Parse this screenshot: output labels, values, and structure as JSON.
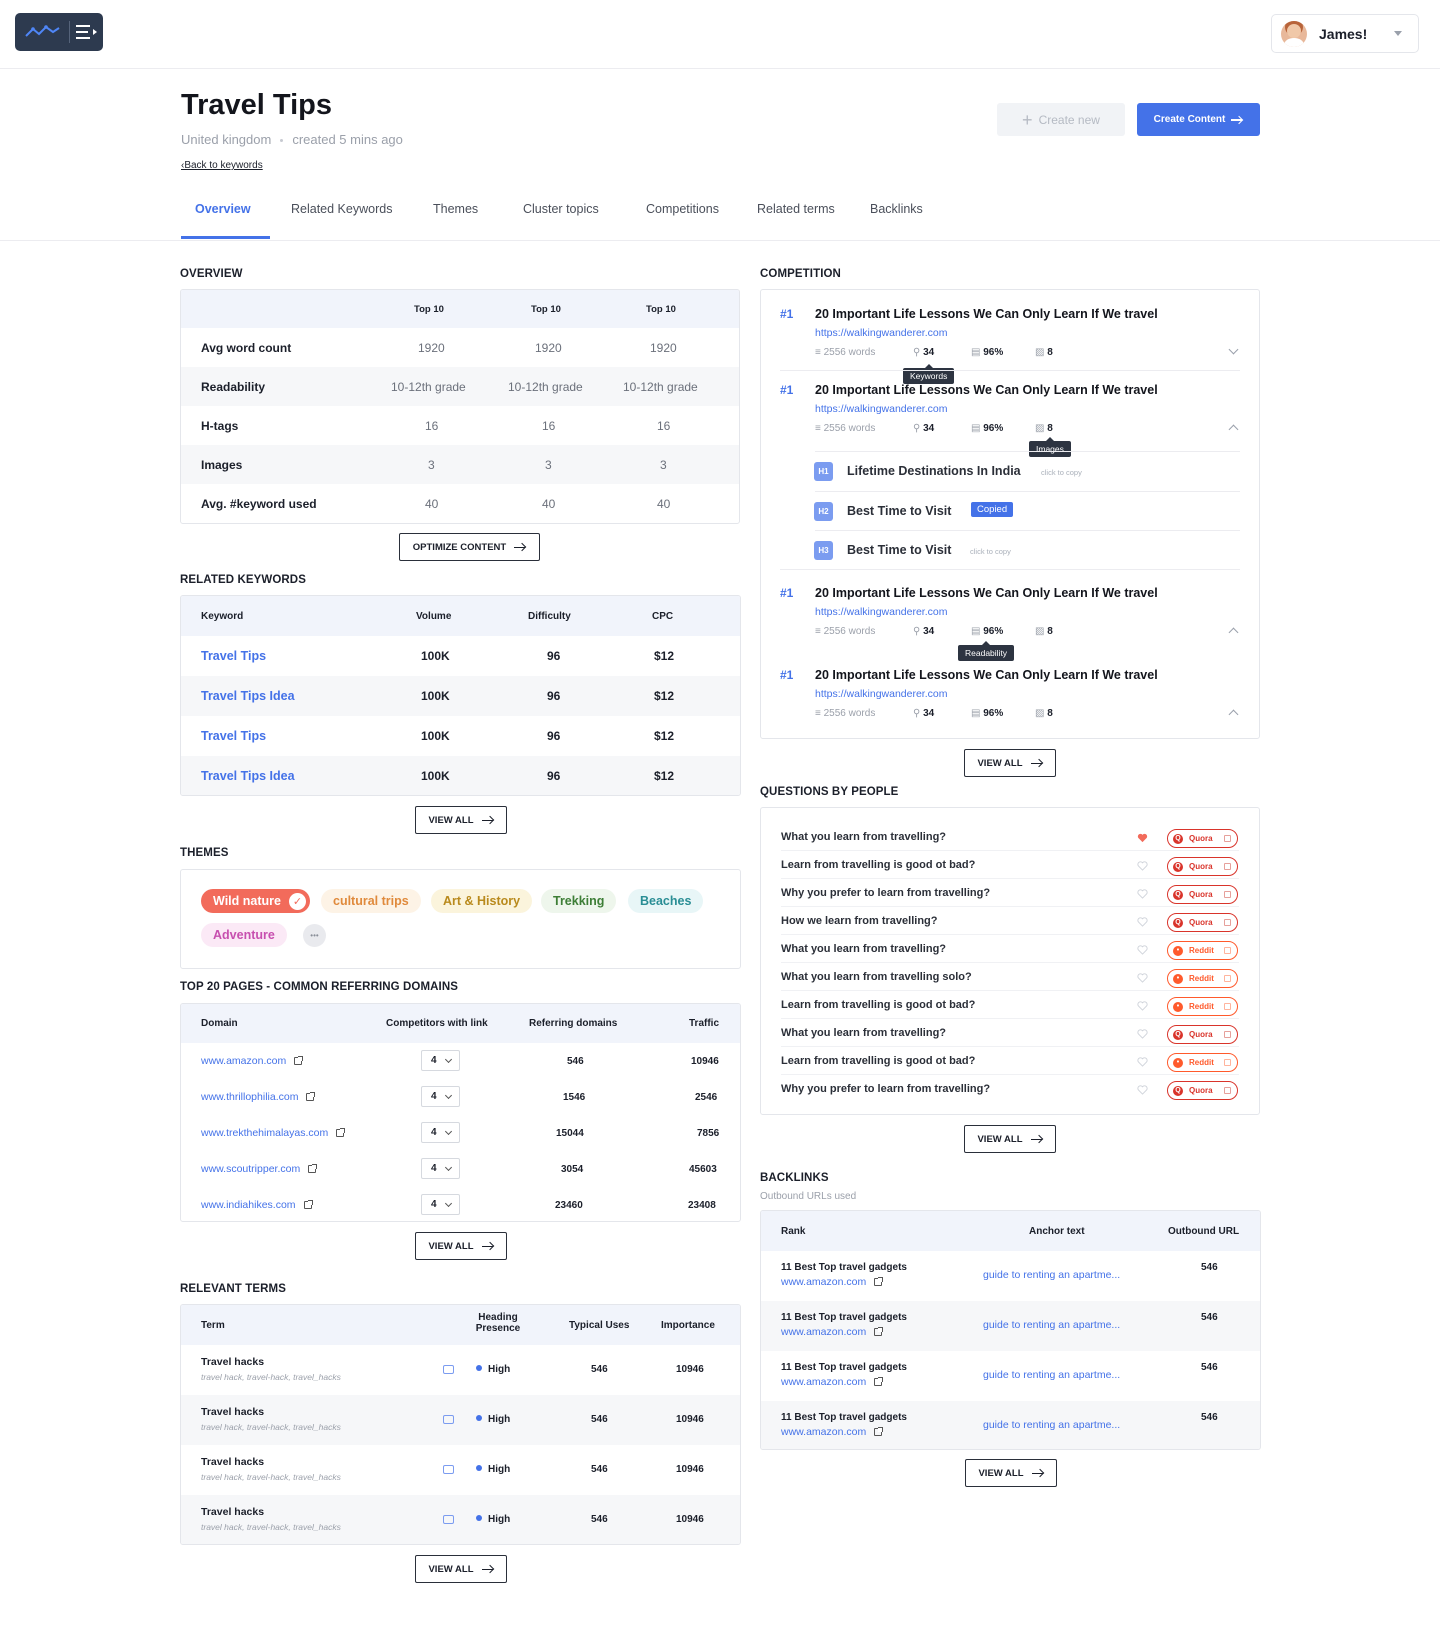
{
  "header": {
    "user_name": "James!"
  },
  "page": {
    "title": "Travel Tips",
    "country": "United kingdom",
    "created": "created 5 mins ago",
    "back_link": "‹Back to keywords",
    "btn_new": "Create new",
    "btn_create": "Create Content"
  },
  "tabs": [
    "Overview",
    "Related Keywords",
    "Themes",
    "Cluster topics",
    "Competitions",
    "Related terms",
    "Backlinks"
  ],
  "overview": {
    "heading": "OVERVIEW",
    "columns": [
      "Top 10",
      "Top 10",
      "Top 10"
    ],
    "rows": [
      {
        "label": "Avg word count",
        "values": [
          "1920",
          "1920",
          "1920"
        ]
      },
      {
        "label": "Readability",
        "values": [
          "10-12th grade",
          "10-12th grade",
          "10-12th grade"
        ]
      },
      {
        "label": "H-tags",
        "values": [
          "16",
          "16",
          "16"
        ]
      },
      {
        "label": "Images",
        "values": [
          "3",
          "3",
          "3"
        ]
      },
      {
        "label": "Avg. #keyword used",
        "values": [
          "40",
          "40",
          "40"
        ]
      }
    ],
    "button": "OPTIMIZE CONTENT"
  },
  "related_keywords": {
    "heading": "RELATED KEYWORDS",
    "columns": [
      "Keyword",
      "Volume",
      "Difficulty",
      "CPC"
    ],
    "rows": [
      {
        "keyword": "Travel Tips",
        "volume": "100K",
        "difficulty": "96",
        "cpc": "$12"
      },
      {
        "keyword": "Travel Tips Idea",
        "volume": "100K",
        "difficulty": "96",
        "cpc": "$12"
      },
      {
        "keyword": "Travel Tips",
        "volume": "100K",
        "difficulty": "96",
        "cpc": "$12"
      },
      {
        "keyword": "Travel Tips Idea",
        "volume": "100K",
        "difficulty": "96",
        "cpc": "$12"
      }
    ],
    "button": "VIEW ALL"
  },
  "themes": {
    "heading": "THEMES",
    "chips": [
      "Wild nature",
      "cultural trips",
      "Art & History",
      "Trekking",
      "Beaches",
      "Adventure"
    ],
    "more": "•••"
  },
  "top_pages": {
    "heading": "TOP 20 PAGES - COMMON REFERRING DOMAINS",
    "columns": [
      "Domain",
      "Competitors with link",
      "Referring domains",
      "Traffic"
    ],
    "rows": [
      {
        "domain": "www.amazon.com",
        "competitors": "4",
        "referring": "546",
        "traffic": "10946"
      },
      {
        "domain": "www.thrillophilia.com",
        "competitors": "4",
        "referring": "1546",
        "traffic": "2546"
      },
      {
        "domain": "www.trekthehimalayas.com",
        "competitors": "4",
        "referring": "15044",
        "traffic": "7856"
      },
      {
        "domain": "www.scoutripper.com",
        "competitors": "4",
        "referring": "3054",
        "traffic": "45603"
      },
      {
        "domain": "www.indiahikes.com",
        "competitors": "4",
        "referring": "23460",
        "traffic": "23408"
      }
    ],
    "button": "VIEW ALL"
  },
  "relevant_terms": {
    "heading": "RELEVANT TERMS",
    "columns": [
      "Term",
      "Heading",
      "Presence",
      "Typical Uses",
      "Importance"
    ],
    "rows": [
      {
        "term": "Travel hacks",
        "variants": "travel hack, travel-hack, travel_hacks",
        "presence": "High",
        "uses": "546",
        "importance": "10946"
      },
      {
        "term": "Travel hacks",
        "variants": "travel hack, travel-hack, travel_hacks",
        "presence": "High",
        "uses": "546",
        "importance": "10946"
      },
      {
        "term": "Travel hacks",
        "variants": "travel hack, travel-hack, travel_hacks",
        "presence": "High",
        "uses": "546",
        "importance": "10946"
      },
      {
        "term": "Travel hacks",
        "variants": "travel hack, travel-hack, travel_hacks",
        "presence": "High",
        "uses": "546",
        "importance": "10946"
      }
    ],
    "button": "VIEW ALL"
  },
  "competition": {
    "heading": "COMPETITION",
    "items": [
      {
        "rank": "#1",
        "title": "20 Important Life Lessons We Can Only Learn If We travel",
        "url": "https://walkingwanderer.com",
        "words": "2556 words",
        "keywords": "34",
        "readability": "96%",
        "images": "8"
      },
      {
        "rank": "#1",
        "title": "20 Important Life Lessons We Can Only Learn If We travel",
        "url": "https://walkingwanderer.com",
        "words": "2556 words",
        "keywords": "34",
        "readability": "96%",
        "images": "8"
      },
      {
        "rank": "#1",
        "title": "20 Important Life Lessons We Can Only Learn If We travel",
        "url": "https://walkingwanderer.com",
        "words": "2556 words",
        "keywords": "34",
        "readability": "96%",
        "images": "8"
      },
      {
        "rank": "#1",
        "title": "20 Important Life Lessons We Can Only Learn If We travel",
        "url": "https://walkingwanderer.com",
        "words": "2556 words",
        "keywords": "34",
        "readability": "96%",
        "images": "8"
      }
    ],
    "tooltips": {
      "keywords": "Keywords",
      "images": "Images",
      "readability": "Readability"
    },
    "headings": [
      {
        "tag": "H1",
        "text": "Lifetime Destinations In India",
        "note": "click to copy"
      },
      {
        "tag": "H2",
        "text": "Best Time to Visit",
        "note": "Copied"
      },
      {
        "tag": "H3",
        "text": "Best Time to Visit",
        "note": "click to copy"
      }
    ],
    "button": "VIEW ALL"
  },
  "questions": {
    "heading": "QUESTIONS BY PEOPLE",
    "items": [
      {
        "q": "What you learn from travelling?",
        "source": "Quora",
        "liked": true
      },
      {
        "q": "Learn from travelling is good ot bad?",
        "source": "Quora",
        "liked": false
      },
      {
        "q": "Why you prefer to learn from travelling?",
        "source": "Quora",
        "liked": false
      },
      {
        "q": "How we learn from travelling?",
        "source": "Quora",
        "liked": false
      },
      {
        "q": "What you learn from travelling?",
        "source": "Reddit",
        "liked": false
      },
      {
        "q": "What you learn from travelling solo?",
        "source": "Reddit",
        "liked": false
      },
      {
        "q": "Learn from travelling is good ot bad?",
        "source": "Reddit",
        "liked": false
      },
      {
        "q": "What you learn from travelling?",
        "source": "Quora",
        "liked": false
      },
      {
        "q": "Learn from travelling is good ot bad?",
        "source": "Reddit",
        "liked": false
      },
      {
        "q": "Why you prefer to learn from travelling?",
        "source": "Quora",
        "liked": false
      }
    ],
    "button": "VIEW ALL"
  },
  "backlinks": {
    "heading": "BACKLINKS",
    "subheading": "Outbound URLs used",
    "columns": [
      "Rank",
      "Anchor text",
      "Outbound URL"
    ],
    "rows": [
      {
        "title": "11 Best Top travel gadgets",
        "domain": "www.amazon.com",
        "anchor": "guide to renting an apartme...",
        "outbound": "546"
      },
      {
        "title": "11 Best Top travel gadgets",
        "domain": "www.amazon.com",
        "anchor": "guide to renting an apartme...",
        "outbound": "546"
      },
      {
        "title": "11 Best Top travel gadgets",
        "domain": "www.amazon.com",
        "anchor": "guide to renting an apartme...",
        "outbound": "546"
      },
      {
        "title": "11 Best Top travel gadgets",
        "domain": "www.amazon.com",
        "anchor": "guide to renting an apartme...",
        "outbound": "546"
      }
    ],
    "button": "VIEW ALL"
  },
  "colors": {
    "accent": "#4472e8",
    "quora": "#d9342b",
    "reddit": "#ff5a2c",
    "coral": "#f26b5b"
  }
}
